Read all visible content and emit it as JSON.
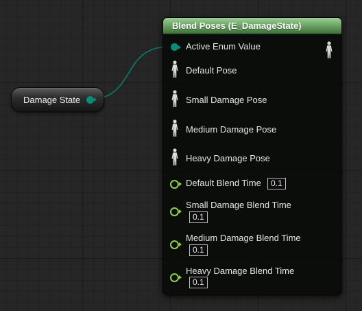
{
  "graph": {
    "variable_node": {
      "label": "Damage State",
      "pin_color": "#0b8b7a"
    },
    "blend_node": {
      "title": "Blend Poses (E_DamageState)",
      "header_color": "#6fa868",
      "enum_input": {
        "label": "Active Enum Value",
        "pin_color": "#0b8b7a"
      },
      "output_pose": {
        "icon": "pose-figure-icon"
      },
      "pose_inputs": [
        {
          "label": "Default Pose",
          "icon": "pose-figure-icon"
        },
        {
          "label": "Small Damage Pose",
          "icon": "pose-figure-icon"
        },
        {
          "label": "Medium Damage Pose",
          "icon": "pose-figure-icon"
        },
        {
          "label": "Heavy Damage Pose",
          "icon": "pose-figure-icon"
        }
      ],
      "blend_time_inputs": [
        {
          "label": "Default Blend Time",
          "value": "0.1"
        },
        {
          "label": "Small Damage Blend Time",
          "value": "0.1"
        },
        {
          "label": "Medium Damage Blend Time",
          "value": "0.1"
        },
        {
          "label": "Heavy Damage Blend Time",
          "value": "0.1"
        }
      ],
      "float_pin_color": "#8fd14a"
    }
  }
}
